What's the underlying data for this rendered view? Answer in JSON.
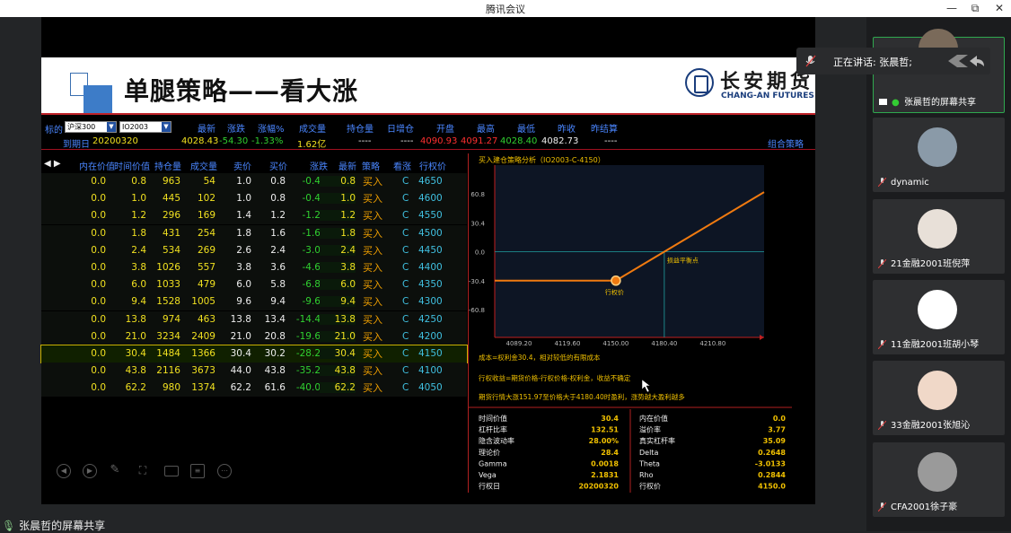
{
  "window": {
    "title": "腾讯会议",
    "min_label": "—",
    "max_label": "⧉",
    "close_label": "✕"
  },
  "slide": {
    "title": "单腿策略——看大涨",
    "logo_cn": "长安期货",
    "logo_en": "CHANG-AN FUTURES"
  },
  "quote": {
    "label_target": "标的",
    "target_value": "沪深300",
    "contract_value": "IO2003",
    "label_expiry": "到期日",
    "expiry": "20200320",
    "headers": [
      "最新",
      "涨跌",
      "涨幅%",
      "成交量",
      "持仓量",
      "日增仓",
      "开盘",
      "最高",
      "最低",
      "昨收",
      "昨结算"
    ],
    "values": [
      "4028.43",
      "-54.30",
      "-1.33%",
      "1.62亿",
      "----",
      "----",
      "4090.93",
      "4091.27",
      "4028.40",
      "4082.73",
      "----"
    ],
    "combo_label": "组合策略"
  },
  "table": {
    "arrows": "◀ ▶",
    "columns": [
      "内在价值",
      "时间价值",
      "持仓量",
      "成交量",
      "卖价",
      "买价",
      "涨跌",
      "最新",
      "策略",
      "看涨",
      "行权价"
    ],
    "rows": [
      [
        "0.0",
        "0.8",
        "963",
        "54",
        "1.0",
        "0.8",
        "-0.4",
        "0.8",
        "买入",
        "C",
        "4650"
      ],
      [
        "0.0",
        "1.0",
        "445",
        "102",
        "1.0",
        "0.8",
        "-0.4",
        "1.0",
        "买入",
        "C",
        "4600"
      ],
      [
        "0.0",
        "1.2",
        "296",
        "169",
        "1.4",
        "1.2",
        "-1.2",
        "1.2",
        "买入",
        "C",
        "4550"
      ],
      [
        "0.0",
        "1.8",
        "431",
        "254",
        "1.8",
        "1.6",
        "-1.6",
        "1.8",
        "买入",
        "C",
        "4500"
      ],
      [
        "0.0",
        "2.4",
        "534",
        "269",
        "2.6",
        "2.4",
        "-3.0",
        "2.4",
        "买入",
        "C",
        "4450"
      ],
      [
        "0.0",
        "3.8",
        "1026",
        "557",
        "3.8",
        "3.6",
        "-4.6",
        "3.8",
        "买入",
        "C",
        "4400"
      ],
      [
        "0.0",
        "6.0",
        "1033",
        "479",
        "6.0",
        "5.8",
        "-6.8",
        "6.0",
        "买入",
        "C",
        "4350"
      ],
      [
        "0.0",
        "9.4",
        "1528",
        "1005",
        "9.6",
        "9.4",
        "-9.6",
        "9.4",
        "买入",
        "C",
        "4300"
      ],
      [
        "0.0",
        "13.8",
        "974",
        "463",
        "13.8",
        "13.4",
        "-14.4",
        "13.8",
        "买入",
        "C",
        "4250"
      ],
      [
        "0.0",
        "21.0",
        "3234",
        "2409",
        "21.0",
        "20.8",
        "-19.6",
        "21.0",
        "买入",
        "C",
        "4200"
      ],
      [
        "0.0",
        "30.4",
        "1484",
        "1366",
        "30.4",
        "30.2",
        "-28.2",
        "30.4",
        "买入",
        "C",
        "4150"
      ],
      [
        "0.0",
        "43.8",
        "2116",
        "3673",
        "44.0",
        "43.8",
        "-35.2",
        "43.8",
        "买入",
        "C",
        "4100"
      ],
      [
        "0.0",
        "62.2",
        "980",
        "1374",
        "62.2",
        "61.6",
        "-40.0",
        "62.2",
        "买入",
        "C",
        "4050"
      ]
    ],
    "selected_row": 10
  },
  "analysis": {
    "title": "买入建仓策略分析（IO2003-C-4150）",
    "breakeven_label": "损益平衡点",
    "strike_label": "行权价",
    "note1": "成本=权利金30.4，相对较低的有限成本",
    "note2": "行权收益=期货价格-行权价格-权利金，收益不确定",
    "note3": "期货行情大涨151.97至价格大于4180.40时盈利，涨势越大盈利越多",
    "stats_left": [
      [
        "时间价值",
        "30.4"
      ],
      [
        "杠杆比率",
        "132.51"
      ],
      [
        "隐含波动率",
        "28.00%"
      ],
      [
        "理论价",
        "28.4"
      ],
      [
        "Gamma",
        "0.0018"
      ],
      [
        "Vega",
        "2.1831"
      ],
      [
        "行权日",
        "20200320"
      ]
    ],
    "stats_right": [
      [
        "内在价值",
        "0.0"
      ],
      [
        "溢价率",
        "3.77"
      ],
      [
        "真实杠杆率",
        "35.09"
      ],
      [
        "Delta",
        "0.2648"
      ],
      [
        "Theta",
        "-3.0133"
      ],
      [
        "Rho",
        "0.2844"
      ],
      [
        "行权价",
        "4150.0"
      ]
    ]
  },
  "chart_data": {
    "type": "line",
    "title": "",
    "xlabel": "",
    "ylabel": "",
    "x_ticks": [
      "4089.20",
      "4119.60",
      "4150.00",
      "4180.40",
      "4210.80"
    ],
    "y_ticks": [
      "60.8",
      "30.4",
      "0.0",
      "-30.4",
      "-60.8"
    ],
    "xlim": [
      4074,
      4243
    ],
    "ylim": [
      -90,
      91
    ],
    "series": [
      {
        "x": [
          4074,
          4150.0,
          4243
        ],
        "y": [
          -30.4,
          -30.4,
          62.6
        ]
      }
    ],
    "annotations": [
      {
        "x": 4150.0,
        "y": -30.4,
        "text": "行权价"
      },
      {
        "x": 4180.4,
        "y": 0.0,
        "text": "损益平衡点"
      }
    ],
    "colors": {
      "line": "#f07a10",
      "axis": "#c02020",
      "ref": "#20a0a0"
    }
  },
  "meeting": {
    "speaking_label": "正在讲话: 张晨哲;",
    "share_label": "张晨哲的屏幕共享",
    "participants": [
      "张晨哲的屏幕共享",
      "dynamic",
      "21金融2001班倪萍",
      "11金融2001班胡小琴",
      "33金融2001张旭沁",
      "CFA2001徐子豪"
    ]
  }
}
